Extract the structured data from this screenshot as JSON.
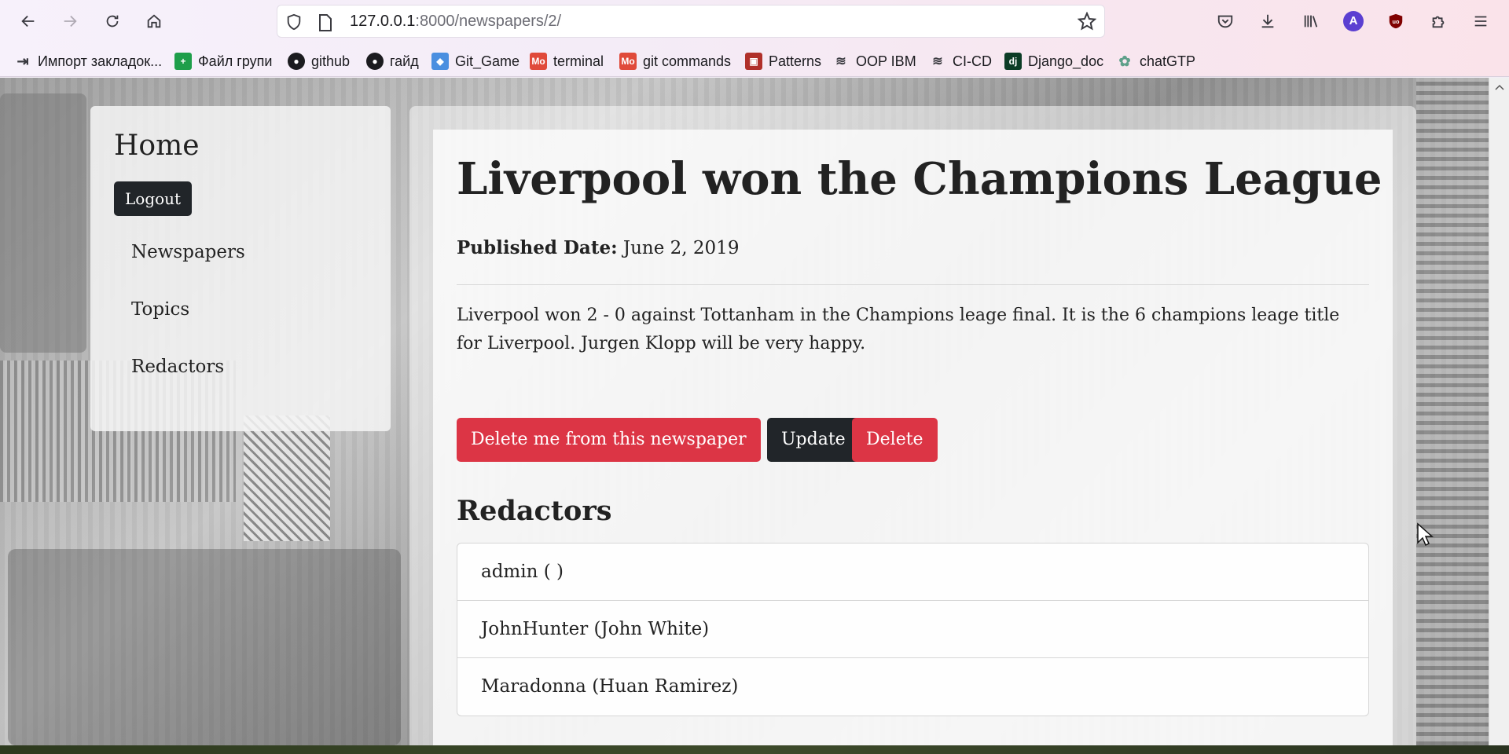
{
  "browser": {
    "url_host": "127.0.0.1",
    "url_rest": ":8000/newspapers/2/",
    "profile_initial": "A",
    "bookmarks": [
      {
        "label": "Импорт закладок...",
        "icon": "import-icon"
      },
      {
        "label": "Файл групи",
        "icon": "sheets-icon"
      },
      {
        "label": "github",
        "icon": "github-icon"
      },
      {
        "label": "гайд",
        "icon": "github-icon"
      },
      {
        "label": "Git_Game",
        "icon": "game-icon"
      },
      {
        "label": "terminal",
        "icon": "mo-icon"
      },
      {
        "label": "git commands",
        "icon": "mo-icon"
      },
      {
        "label": "Patterns",
        "icon": "patterns-icon"
      },
      {
        "label": "OOP IBM",
        "icon": "ibm-icon"
      },
      {
        "label": "CI-CD",
        "icon": "ibm-icon"
      },
      {
        "label": "Django_doc",
        "icon": "django-icon"
      },
      {
        "label": "chatGTP",
        "icon": "openai-icon"
      }
    ]
  },
  "sidebar": {
    "title": "Home",
    "logout_label": "Logout",
    "links": [
      "Newspapers",
      "Topics",
      "Redactors"
    ]
  },
  "article": {
    "title": "Liverpool won the Champions League",
    "published_label": "Published Date:",
    "published_date": "June 2, 2019",
    "body": "Liverpool won 2 - 0 against Tottanham in the Champions leage final. It is the 6 champions leage title for Liverpool. Jurgen Klopp will be very happy.",
    "buttons": {
      "remove": "Delete me from this newspaper",
      "update": "Update",
      "delete": "Delete"
    },
    "redactors_heading": "Redactors",
    "redactors": [
      "admin ( )",
      "JohnHunter (John White)",
      "Maradonna (Huan Ramirez)"
    ]
  },
  "colors": {
    "danger": "#dc3545",
    "dark": "#212529"
  }
}
